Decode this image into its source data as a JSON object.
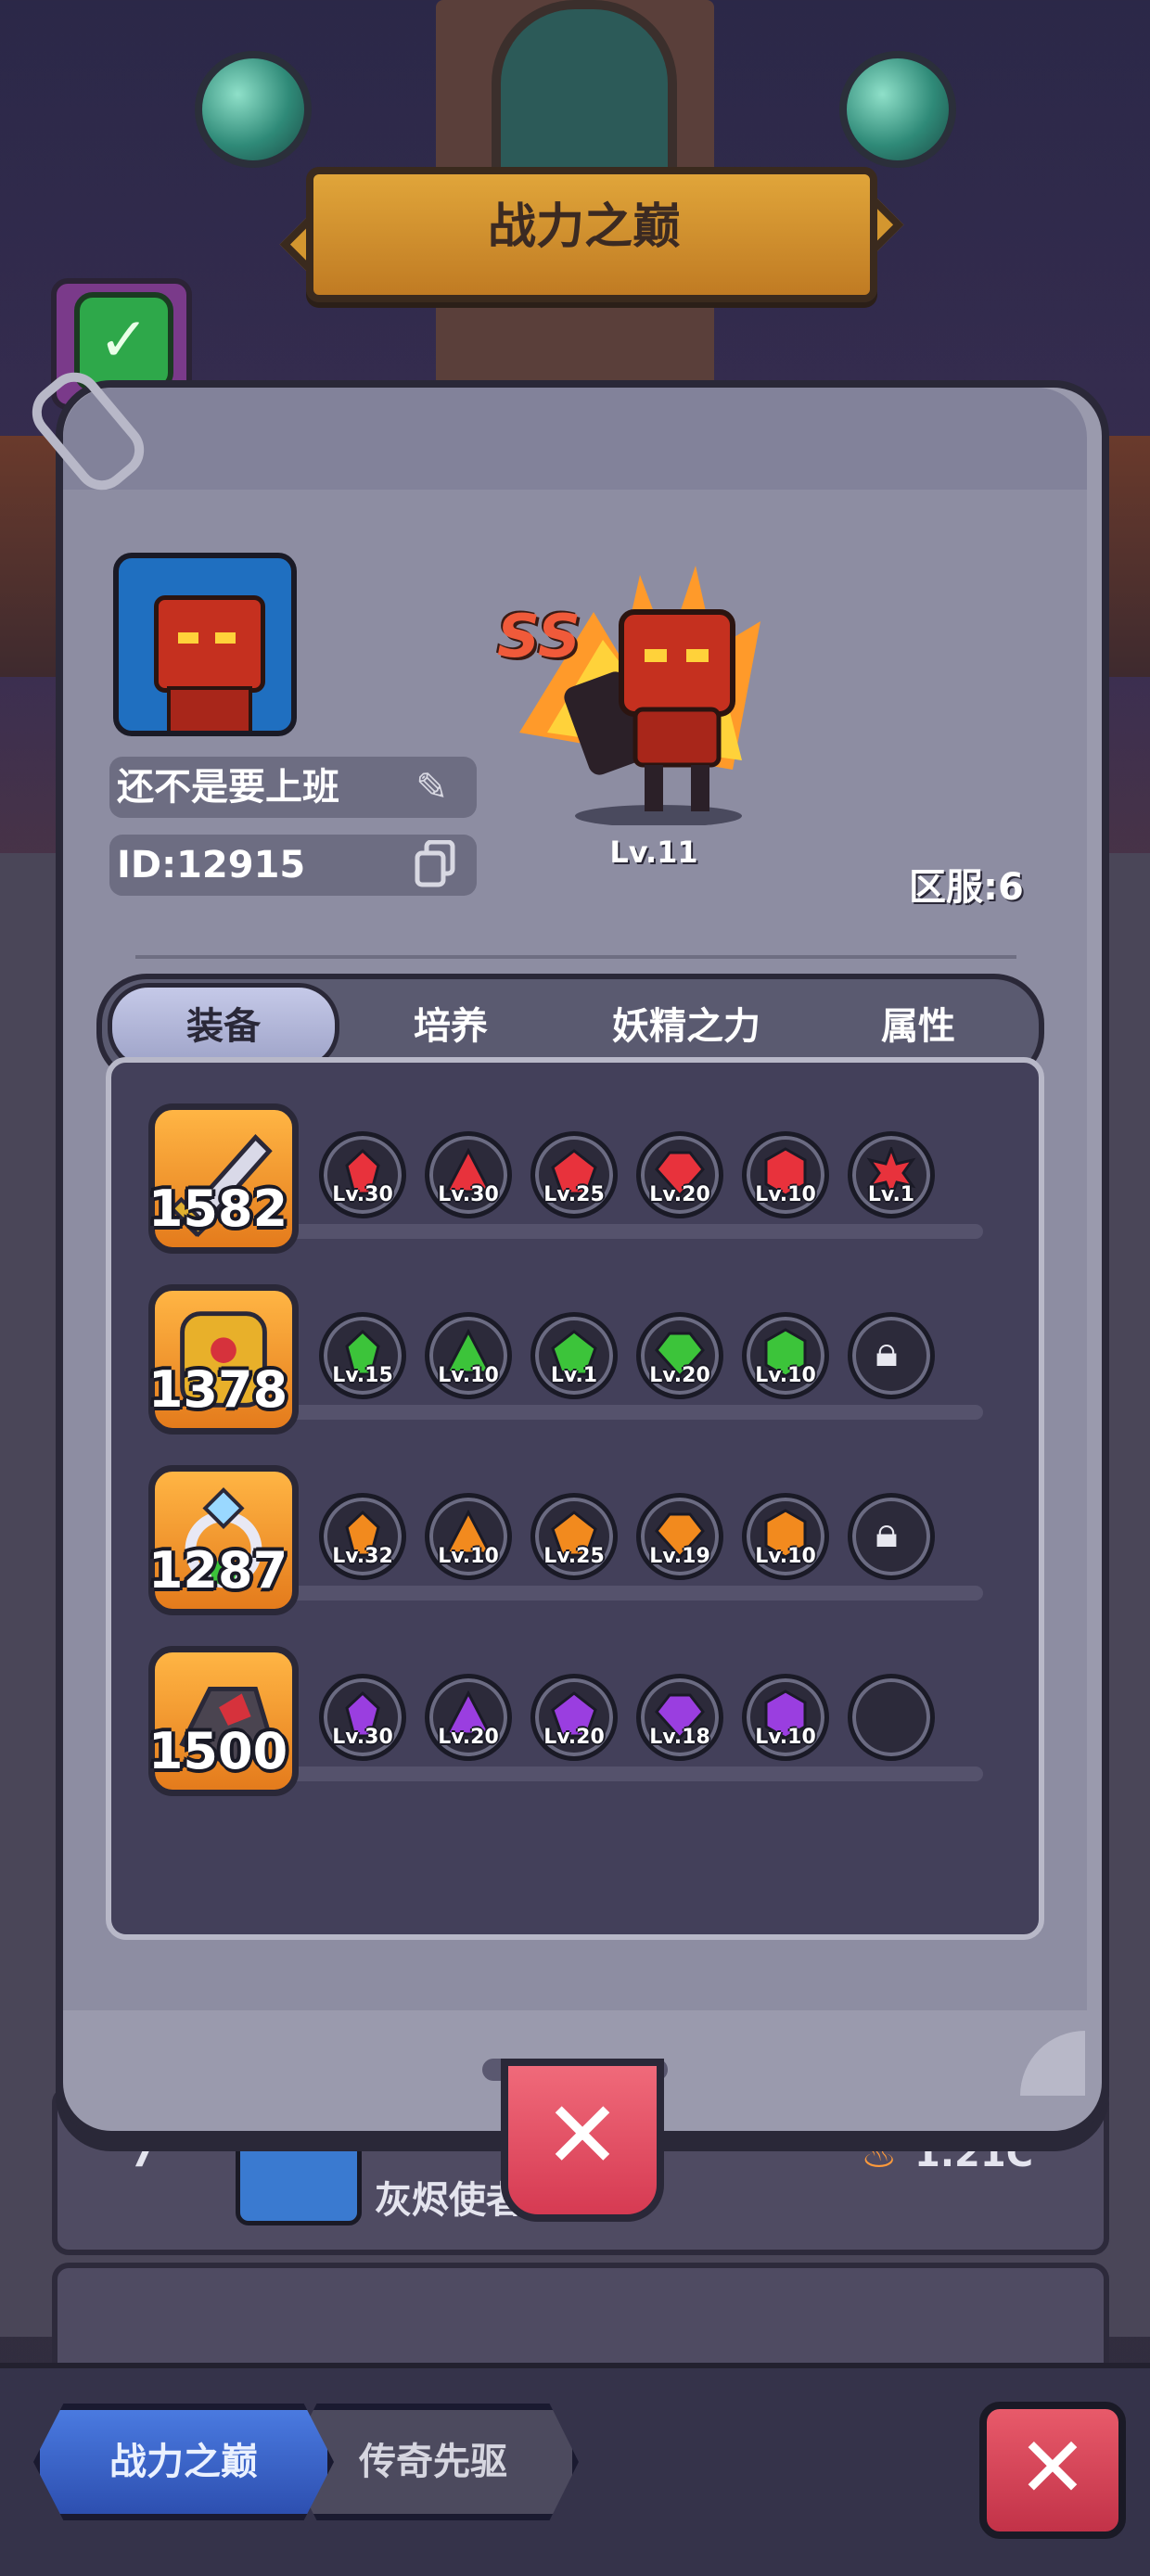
{
  "banner": {
    "title": "战力之巅"
  },
  "profile": {
    "name": "还不是要上班",
    "id_text": "ID:12915",
    "hero_grade": "SS",
    "hero_level": "Lv.11",
    "server": "区服:6"
  },
  "tabs": [
    {
      "label": "装备",
      "active": true
    },
    {
      "label": "培养",
      "active": false
    },
    {
      "label": "妖精之力",
      "active": false
    },
    {
      "label": "属性",
      "active": false
    }
  ],
  "equipment": [
    {
      "slot": "sword",
      "power": "1582",
      "gem_color": "#e8323c",
      "gems": [
        "Lv.30",
        "Lv.30",
        "Lv.25",
        "Lv.20",
        "Lv.10",
        "Lv.1"
      ]
    },
    {
      "slot": "armor",
      "power": "1378",
      "gem_color": "#3cc43a",
      "gems": [
        "Lv.15",
        "Lv.10",
        "Lv.1",
        "Lv.20",
        "Lv.10"
      ],
      "last": "locked"
    },
    {
      "slot": "ring",
      "power": "1287",
      "gem_color": "#f28a1e",
      "gems": [
        "Lv.32",
        "Lv.10",
        "Lv.25",
        "Lv.19",
        "Lv.10"
      ],
      "last": "locked"
    },
    {
      "slot": "gauntlet",
      "power": "1500",
      "gem_color": "#9a3ee0",
      "gems": [
        "Lv.30",
        "Lv.20",
        "Lv.20",
        "Lv.18",
        "Lv.10"
      ],
      "last": "empty"
    }
  ],
  "ranking_behind": [
    {
      "rank": "7",
      "name": "灰烬使者",
      "score": "1.21C"
    }
  ],
  "bottom_tabs": [
    {
      "label": "战力之巅",
      "active": true
    },
    {
      "label": "传奇先驱",
      "active": false
    }
  ],
  "icons": {
    "edit": "pencil-icon",
    "copy": "copy-icon",
    "close": "close-icon",
    "lock": "lock-icon",
    "check": "check-icon"
  }
}
